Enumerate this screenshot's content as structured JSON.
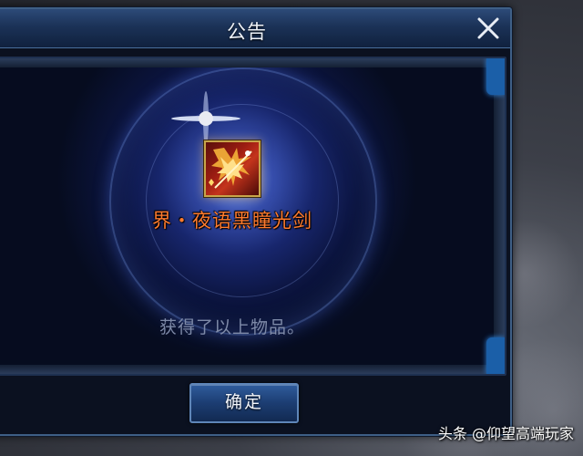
{
  "dialog": {
    "title": "公告",
    "close_icon": "close-icon",
    "item": {
      "icon": "sword-item-icon",
      "name": "界・夜语黑瞳光剑"
    },
    "message": "获得了以上物品。",
    "confirm_label": "确定"
  },
  "watermark": {
    "text": "头条 @仰望高端玩家"
  },
  "colors": {
    "item_name": "#ff7b2e",
    "message": "#7e8aa8",
    "title_bar": "#1b3257",
    "button": "#1c3d72",
    "icon_frame": "#c8a54a"
  }
}
